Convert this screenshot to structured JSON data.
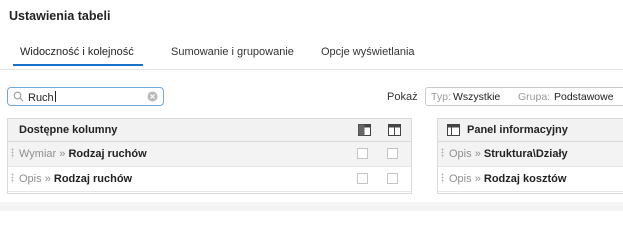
{
  "title": "Ustawienia tabeli",
  "tabs": [
    {
      "label": "Widoczność i kolejność",
      "active": true
    },
    {
      "label": "Sumowanie i grupowanie",
      "active": false
    },
    {
      "label": "Opcje wyświetlania",
      "active": false
    }
  ],
  "search": {
    "value": "Ruch",
    "icon": "search-icon",
    "clear_icon": "clear-icon"
  },
  "filter": {
    "show_label": "Pokaż",
    "type_label": "Typ:",
    "type_value": "Wszystkie",
    "group_label": "Grupa:",
    "group_value": "Podstawowe"
  },
  "available_columns": {
    "header": "Dostępne kolumny",
    "rows": [
      {
        "prefix": "Wymiar",
        "separator": "»",
        "name": "Rodzaj ruchów"
      },
      {
        "prefix": "Opis",
        "separator": "»",
        "name": "Rodzaj ruchów"
      }
    ]
  },
  "info_panel": {
    "header": "Panel informacyjny",
    "rows": [
      {
        "prefix": "Opis",
        "separator": "»",
        "name": "Struktura\\Działy"
      },
      {
        "prefix": "Opis",
        "separator": "»",
        "name": "Rodzaj kosztów"
      }
    ]
  },
  "colors": {
    "accent": "#1a73c8",
    "search_border": "#6fa8dc"
  }
}
